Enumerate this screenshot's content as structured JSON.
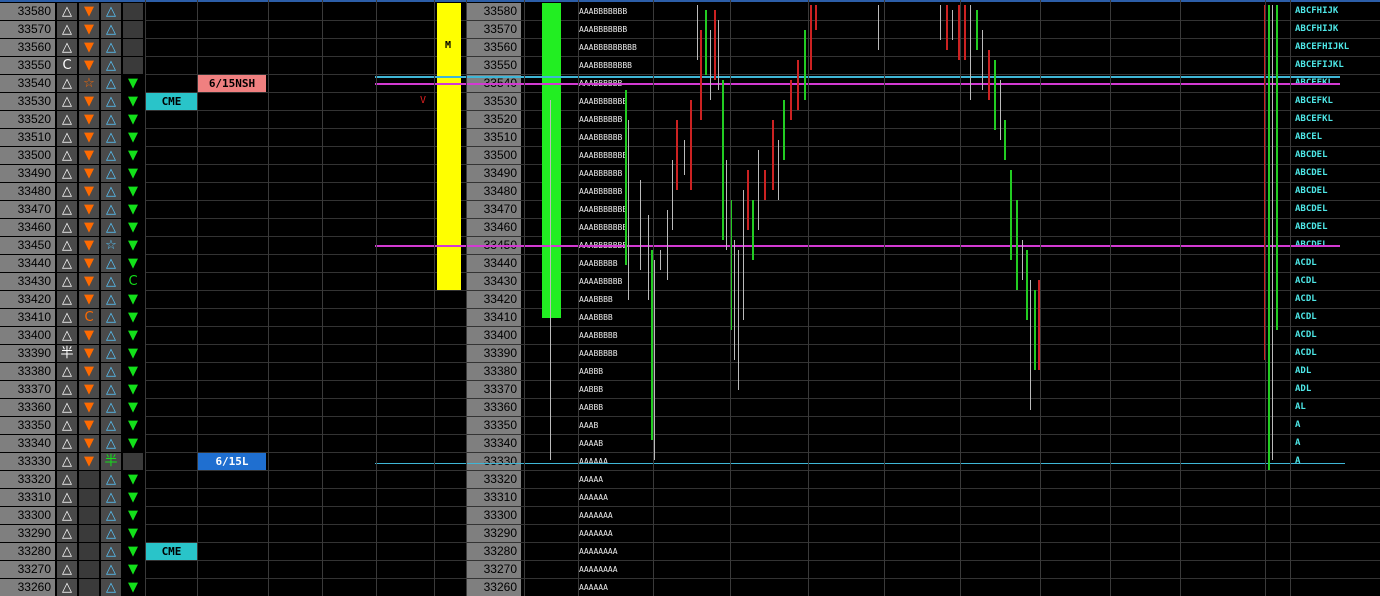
{
  "prices": [
    "33580",
    "33570",
    "33560",
    "33550",
    "33540",
    "33530",
    "33520",
    "33510",
    "33500",
    "33490",
    "33480",
    "33470",
    "33460",
    "33450",
    "33440",
    "33430",
    "33420",
    "33410",
    "33400",
    "33390",
    "33380",
    "33370",
    "33360",
    "33350",
    "33340",
    "33330",
    "33320",
    "33310",
    "33300",
    "33290",
    "33280",
    "33270",
    "33260"
  ],
  "col1": [
    "tri",
    "tri",
    "tri",
    "C",
    "tri",
    "tri",
    "tri",
    "tri",
    "tri",
    "tri",
    "tri",
    "tri",
    "tri",
    "tri",
    "tri",
    "tri",
    "tri",
    "tri",
    "tri",
    "yen",
    "tri",
    "tri",
    "tri",
    "tri",
    "tri",
    "tri",
    "tri",
    "tri",
    "tri",
    "tri",
    "tri",
    "tri",
    "tri"
  ],
  "col2": [
    "down",
    "down",
    "down",
    "down",
    "star",
    "down",
    "down",
    "down",
    "down",
    "down",
    "down",
    "down",
    "down",
    "down",
    "down",
    "down",
    "down",
    "C",
    "down",
    "down",
    "down",
    "down",
    "down",
    "down",
    "down",
    "down",
    "",
    "",
    "",
    "",
    "",
    "",
    ""
  ],
  "col3": [
    "tri",
    "tri",
    "tri",
    "tri",
    "tri",
    "tri",
    "tri",
    "tri",
    "tri",
    "tri",
    "tri",
    "tri",
    "tri",
    "star",
    "tri",
    "tri",
    "tri",
    "tri",
    "tri",
    "tri",
    "tri",
    "tri",
    "tri",
    "tri",
    "tri",
    "yen",
    "tri",
    "tri",
    "tri",
    "tri",
    "tri",
    "tri",
    "tri"
  ],
  "col4": [
    "",
    "",
    "",
    "",
    "down",
    "down",
    "down",
    "down",
    "down",
    "down",
    "down",
    "down",
    "down",
    "down",
    "down",
    "C",
    "down",
    "down",
    "down",
    "down",
    "down",
    "down",
    "down",
    "down",
    "down",
    "",
    "down",
    "down",
    "down",
    "down",
    "down",
    "down",
    "down"
  ],
  "labels": {
    "cme_top": "CME",
    "cme_bottom": "CME",
    "nsh": "6/15NSH",
    "low": "6/15L",
    "m_marker": "M",
    "v_marker": "V"
  },
  "tpo_left": [
    "AAABBBBBBB",
    "AAABBBBBBB",
    "AAABBBBBBBBB",
    "AAABBBBBBBB",
    "AAABBBBBB",
    "AAABBBBBBB",
    "AAABBBBBB",
    "AAABBBBBB",
    "AAABBBBBBB",
    "AAABBBBBB",
    "AAABBBBBB",
    "AAABBBBBBB",
    "AAABBBBBBB",
    "AAABBBBBBB",
    "AAABBBBB",
    "AAAABBBBB",
    "AAABBBB",
    "AAABBBB",
    "AAABBBBB",
    "AAABBBBB",
    "AABBB",
    "AABBB",
    "AABBB",
    "AAAB",
    "AAAAB",
    "AAAAAA",
    "AAAAA",
    "AAAAAA",
    "AAAAAAA",
    "AAAAAAA",
    "AAAAAAAA",
    "AAAAAAAA",
    "AAAAAA"
  ],
  "tpo_right": [
    "ABCFHIJK",
    "ABCFHIJK",
    "ABCEFHIJKL",
    "ABCEFIJKL",
    "ABCEFKL",
    "ABCEFKL",
    "ABCEFKL",
    "ABCEL",
    "ABCDEL",
    "ABCDEL",
    "ABCDEL",
    "ABCDEL",
    "ABCDEL",
    "ABCDEL",
    "ACDL",
    "ACDL",
    "ACDL",
    "ACDL",
    "ACDL",
    "ACDL",
    "ADL",
    "ADL",
    "AL",
    "A",
    "A",
    "A",
    "",
    "",
    "",
    "",
    "",
    "",
    ""
  ],
  "colors": {
    "cyan_line": "#3fb6d6",
    "magenta_line": "#d23ad2",
    "yellow_bar": "#ffff00",
    "green_bar": "#22ee22",
    "cme_bg": "#29c4c9",
    "nsh_bg": "#f08080",
    "low_bg": "#1f6fd0"
  }
}
